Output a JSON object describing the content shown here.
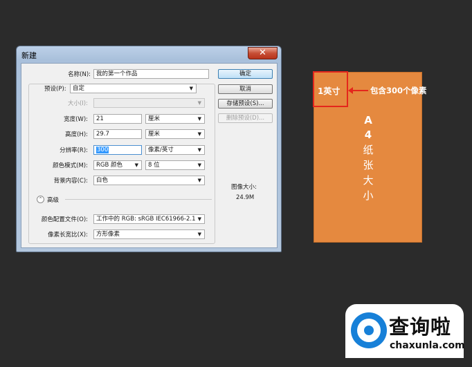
{
  "dialog": {
    "title": "新建",
    "close_glyph": "✕",
    "fields": {
      "name": {
        "label": "名称(N):",
        "value": "我的第一个作品"
      },
      "preset": {
        "label": "预设(P):",
        "value": "自定"
      },
      "size": {
        "label": "大小(I):",
        "value": ""
      },
      "width": {
        "label": "宽度(W):",
        "value": "21",
        "unit": "厘米"
      },
      "height": {
        "label": "高度(H):",
        "value": "29.7",
        "unit": "厘米"
      },
      "resolution": {
        "label": "分辨率(R):",
        "value": "300",
        "unit": "像素/英寸"
      },
      "color_mode": {
        "label": "颜色模式(M):",
        "value": "RGB 颜色",
        "depth": "8 位"
      },
      "background": {
        "label": "背景内容(C):",
        "value": "白色"
      },
      "color_profile": {
        "label": "颜色配置文件(O):",
        "value": "工作中的 RGB: sRGB IEC61966-2.1"
      },
      "pixel_aspect": {
        "label": "像素长宽比(X):",
        "value": "方形像素"
      }
    },
    "advanced_label": "高级",
    "advanced_glyph": "⌃",
    "buttons": {
      "ok": "确定",
      "cancel": "取消",
      "save_preset": "存储预设(S)...",
      "delete_preset": "删除预设(D)..."
    },
    "image_size": {
      "label": "图像大小:",
      "value": "24.9M"
    }
  },
  "illustration": {
    "inch_label": "1英寸",
    "pixel_label": "包含300个像素",
    "chars": [
      "A",
      "4",
      "纸",
      "张",
      "大",
      "小"
    ]
  },
  "watermark": {
    "name": "查询啦",
    "url": "chaxunla.com"
  }
}
